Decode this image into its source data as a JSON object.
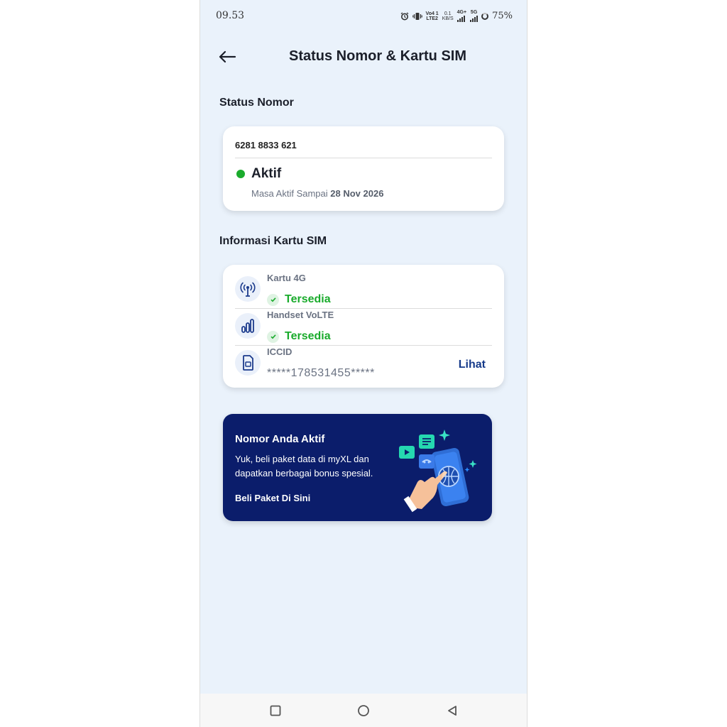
{
  "status_bar": {
    "time": "09.53",
    "volte_top": "Vo4 1",
    "volte_bottom": "LTE2",
    "speed_top": "0.1",
    "speed_bottom": "KB/S",
    "net1": "4G+",
    "net2": "5G",
    "battery": "75%"
  },
  "header": {
    "title": "Status Nomor & Kartu SIM"
  },
  "status_nomor": {
    "section_title": "Status Nomor",
    "number": "6281 8833 621",
    "status": "Aktif",
    "status_color": "#1aab2c",
    "masa_prefix": "Masa Aktif Sampai ",
    "masa_date": "28 Nov 2026"
  },
  "sim_info": {
    "section_title": "Informasi Kartu SIM",
    "kartu_label": "Kartu 4G",
    "kartu_status": "Tersedia",
    "handset_label": "Handset VoLTE",
    "handset_status": "Tersedia",
    "iccid_label": "ICCID",
    "iccid_value": "*****178531455*****",
    "lihat": "Lihat",
    "icons": [
      "antenna-icon",
      "signal-bars-icon",
      "sim-card-icon"
    ]
  },
  "banner": {
    "title": "Nomor Anda Aktif",
    "desc": "Yuk, beli paket data di myXL dan dapatkan berbagai bonus spesial.",
    "cta": "Beli Paket Di Sini",
    "bg_color": "#0b1d6b"
  },
  "nav": {
    "icons": [
      "recent-apps-icon",
      "home-icon",
      "back-triangle-icon"
    ]
  }
}
